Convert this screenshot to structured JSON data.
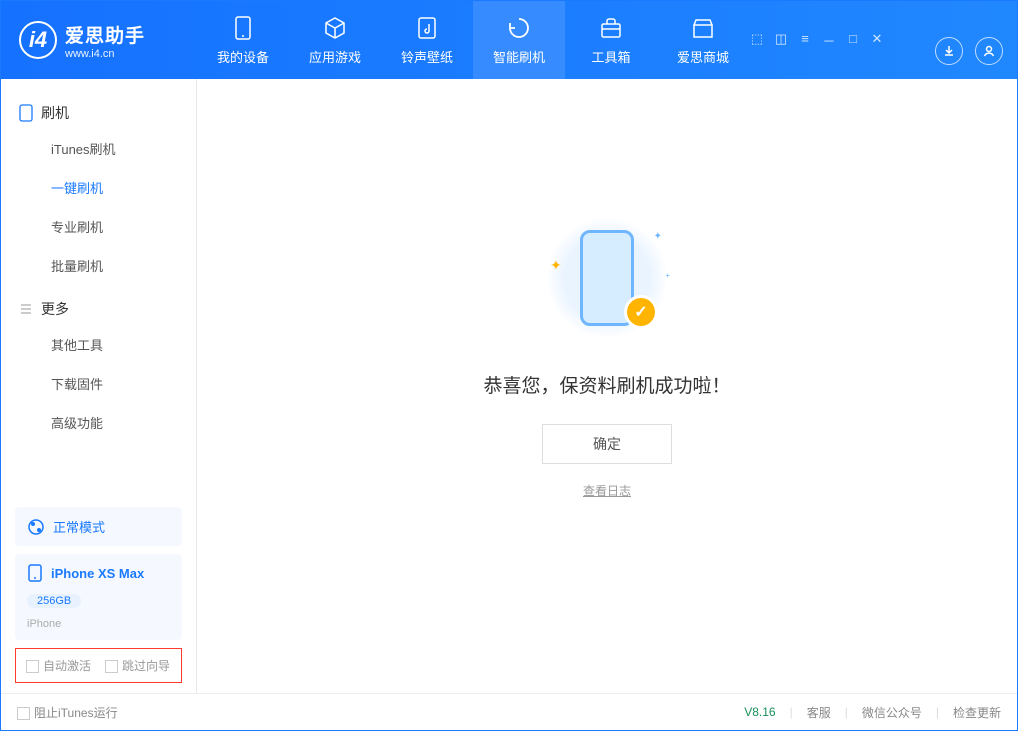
{
  "header": {
    "logo_title": "爱思助手",
    "logo_sub": "www.i4.cn",
    "tabs": [
      {
        "label": "我的设备"
      },
      {
        "label": "应用游戏"
      },
      {
        "label": "铃声壁纸"
      },
      {
        "label": "智能刷机"
      },
      {
        "label": "工具箱"
      },
      {
        "label": "爱思商城"
      }
    ]
  },
  "sidebar": {
    "section1_title": "刷机",
    "section1_items": [
      "iTunes刷机",
      "一键刷机",
      "专业刷机",
      "批量刷机"
    ],
    "section2_title": "更多",
    "section2_items": [
      "其他工具",
      "下载固件",
      "高级功能"
    ],
    "mode_label": "正常模式",
    "device_name": "iPhone XS Max",
    "device_storage": "256GB",
    "device_type": "iPhone",
    "chk1_label": "自动激活",
    "chk2_label": "跳过向导"
  },
  "main": {
    "success_message": "恭喜您，保资料刷机成功啦！",
    "confirm_button": "确定",
    "log_link": "查看日志"
  },
  "footer": {
    "block_itunes": "阻止iTunes运行",
    "version": "V8.16",
    "links": [
      "客服",
      "微信公众号",
      "检查更新"
    ]
  }
}
